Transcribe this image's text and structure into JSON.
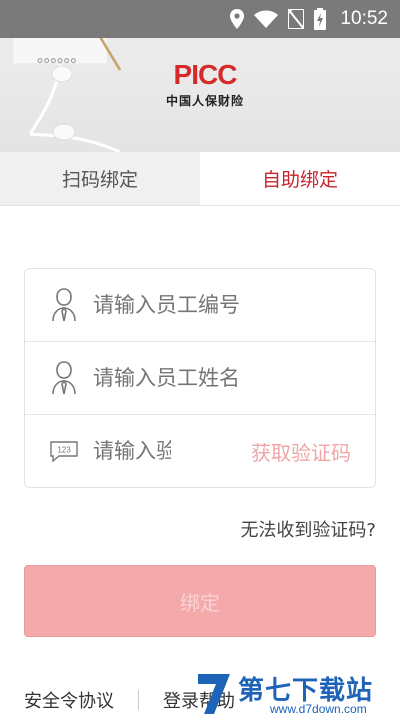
{
  "status_bar": {
    "time": "10:52",
    "icons": [
      "location-icon",
      "wifi-icon",
      "no-sim-icon",
      "battery-charging-icon"
    ]
  },
  "header": {
    "logo_text": "PICC",
    "logo_subtitle": "中国人保财险"
  },
  "tabs": [
    {
      "label": "扫码绑定",
      "active": false
    },
    {
      "label": "自助绑定",
      "active": true
    }
  ],
  "form": {
    "employee_id": {
      "placeholder": "请输入员工编号",
      "icon": "person-icon"
    },
    "employee_name": {
      "placeholder": "请输入员工姓名",
      "icon": "person-icon"
    },
    "verification_code": {
      "placeholder": "请输入验证码",
      "icon": "keypad-123-icon",
      "icon_text": "123"
    },
    "get_code_label": "获取验证码"
  },
  "cant_receive_label": "无法收到验证码?",
  "bind_button_label": "绑定",
  "footer": {
    "agreement_label": "安全令协议",
    "help_label": "登录帮助"
  },
  "watermark": {
    "text": "第七下载站",
    "url": "www.d7down.com"
  },
  "colors": {
    "accent": "#c8252c",
    "button_disabled": "#f4a9ab",
    "get_code_disabled": "#f0a6a6"
  }
}
